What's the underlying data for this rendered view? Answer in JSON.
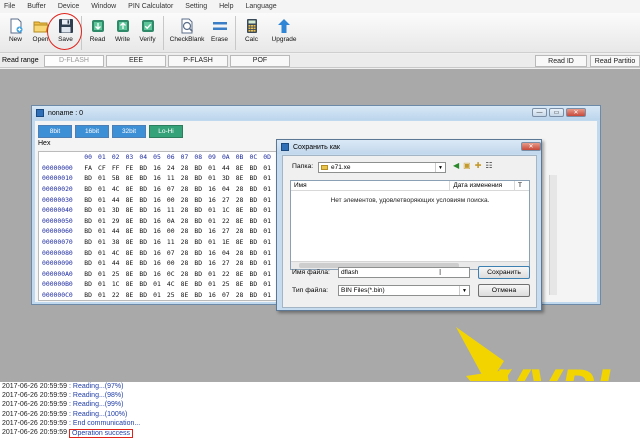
{
  "menu": [
    "File",
    "Buffer",
    "Device",
    "Window",
    "PIN Calculator",
    "Setting",
    "Help",
    "Language"
  ],
  "toolbar": [
    {
      "id": "new",
      "label": "New",
      "icon": "new-file-icon"
    },
    {
      "id": "open",
      "label": "Open",
      "icon": "open-folder-icon"
    },
    {
      "id": "save",
      "label": "Save",
      "icon": "floppy-disk-icon"
    },
    {
      "id": "read",
      "label": "Read",
      "icon": "read-chip-icon"
    },
    {
      "id": "write",
      "label": "Write",
      "icon": "write-chip-icon"
    },
    {
      "id": "verify",
      "label": "Verify",
      "icon": "verify-chip-icon"
    },
    {
      "id": "checkblank",
      "label": "CheckBlank",
      "icon": "checkblank-icon"
    },
    {
      "id": "erase",
      "label": "Erase",
      "icon": "erase-icon"
    },
    {
      "id": "calc",
      "label": "Calc",
      "icon": "calculator-icon"
    },
    {
      "id": "upgrade",
      "label": "Upgrade",
      "icon": "upgrade-arrow-icon"
    }
  ],
  "tabs": {
    "read_range_label": "Read range",
    "items": [
      "D-FLASH",
      "EEE",
      "P-FLASH",
      "POF"
    ],
    "read_id": "Read ID",
    "read_partition": "Read Partitio"
  },
  "hex_window": {
    "title": "noname : 0",
    "modes": [
      "8bit",
      "16bit",
      "32bit",
      "Lo-Hi"
    ],
    "section_label": "Hex",
    "columns": [
      "00",
      "01",
      "02",
      "03",
      "04",
      "05",
      "06",
      "07",
      "08",
      "09",
      "0A",
      "0B",
      "0C",
      "0D"
    ],
    "rows": [
      {
        "addr": "00000000",
        "bytes": [
          "FA",
          "CF",
          "FF",
          "FE",
          "BD",
          "16",
          "24",
          "28",
          "BD",
          "01",
          "44",
          "8E",
          "BD",
          "01"
        ]
      },
      {
        "addr": "00000010",
        "bytes": [
          "BD",
          "01",
          "5B",
          "8E",
          "BD",
          "16",
          "11",
          "28",
          "BD",
          "01",
          "3D",
          "8E",
          "BD",
          "01"
        ]
      },
      {
        "addr": "00000020",
        "bytes": [
          "BD",
          "01",
          "4C",
          "8E",
          "BD",
          "16",
          "07",
          "28",
          "BD",
          "16",
          "04",
          "28",
          "BD",
          "01"
        ]
      },
      {
        "addr": "00000030",
        "bytes": [
          "BD",
          "01",
          "44",
          "8E",
          "BD",
          "16",
          "00",
          "28",
          "BD",
          "16",
          "27",
          "28",
          "BD",
          "01"
        ]
      },
      {
        "addr": "00000040",
        "bytes": [
          "BD",
          "01",
          "3D",
          "8E",
          "BD",
          "16",
          "11",
          "28",
          "BD",
          "01",
          "1C",
          "8E",
          "BD",
          "01"
        ]
      },
      {
        "addr": "00000050",
        "bytes": [
          "BD",
          "01",
          "29",
          "8E",
          "BD",
          "16",
          "0A",
          "28",
          "BD",
          "01",
          "22",
          "8E",
          "BD",
          "01"
        ]
      },
      {
        "addr": "00000060",
        "bdytes": [],
        "bytes": [
          "BD",
          "01",
          "44",
          "8E",
          "BD",
          "16",
          "00",
          "28",
          "BD",
          "16",
          "27",
          "28",
          "BD",
          "01"
        ]
      },
      {
        "addr": "00000070",
        "bytes": [
          "BD",
          "01",
          "38",
          "8E",
          "BD",
          "16",
          "11",
          "28",
          "BD",
          "01",
          "1E",
          "8E",
          "BD",
          "01"
        ]
      },
      {
        "addr": "00000080",
        "bytes": [
          "BD",
          "01",
          "4C",
          "8E",
          "BD",
          "16",
          "07",
          "28",
          "BD",
          "16",
          "04",
          "28",
          "BD",
          "01"
        ]
      },
      {
        "addr": "00000090",
        "bytes": [
          "BD",
          "01",
          "44",
          "8E",
          "BD",
          "16",
          "00",
          "28",
          "BD",
          "16",
          "27",
          "28",
          "BD",
          "01"
        ]
      },
      {
        "addr": "000000A0",
        "bytes": [
          "BD",
          "01",
          "25",
          "8E",
          "BD",
          "16",
          "0C",
          "28",
          "BD",
          "01",
          "22",
          "8E",
          "BD",
          "01"
        ]
      },
      {
        "addr": "000000B0",
        "bytes": [
          "BD",
          "01",
          "1C",
          "8E",
          "BD",
          "01",
          "4C",
          "8E",
          "BD",
          "01",
          "25",
          "8E",
          "BD",
          "01"
        ]
      },
      {
        "addr": "000000C0",
        "bytes": [
          "BD",
          "01",
          "22",
          "8E",
          "BD",
          "01",
          "25",
          "8E",
          "BD",
          "16",
          "07",
          "28",
          "BD",
          "01"
        ]
      }
    ]
  },
  "save_dialog": {
    "title": "Сохранить как",
    "folder_label": "Папка:",
    "folder_value": "e71.xe",
    "col_name": "Имя",
    "col_date": "Дата изменения",
    "col_t": "Т",
    "empty_message": "Нет элементов, удовлетворяющих условиям поиска.",
    "filename_label": "Имя файла:",
    "filename_value": "dflash",
    "filetype_label": "Тип файла:",
    "filetype_value": "BIN Files(*.bin)",
    "save_button": "Сохранить",
    "cancel_button": "Отмена"
  },
  "log": [
    {
      "ts": "2017-06-26 20:59:59",
      "msg": ": Reading...(97%)"
    },
    {
      "ts": "2017-06-26 20:59:59",
      "msg": ": Reading...(98%)"
    },
    {
      "ts": "2017-06-26 20:59:59",
      "msg": ": Reading...(99%)"
    },
    {
      "ts": "2017-06-26 20:59:59",
      "msg": ": Reading...(100%)"
    },
    {
      "ts": "2017-06-26 20:59:59",
      "msg": ": End communication..."
    },
    {
      "ts": "2017-06-26 20:59:59",
      "msg": "Operation success"
    }
  ],
  "logo_text": "VVDI",
  "colors": {
    "accent_red": "#e0221b",
    "mode_blue": "#3d8fd6",
    "mode_green": "#36a27a",
    "logo_yellow": "#f2d500"
  }
}
